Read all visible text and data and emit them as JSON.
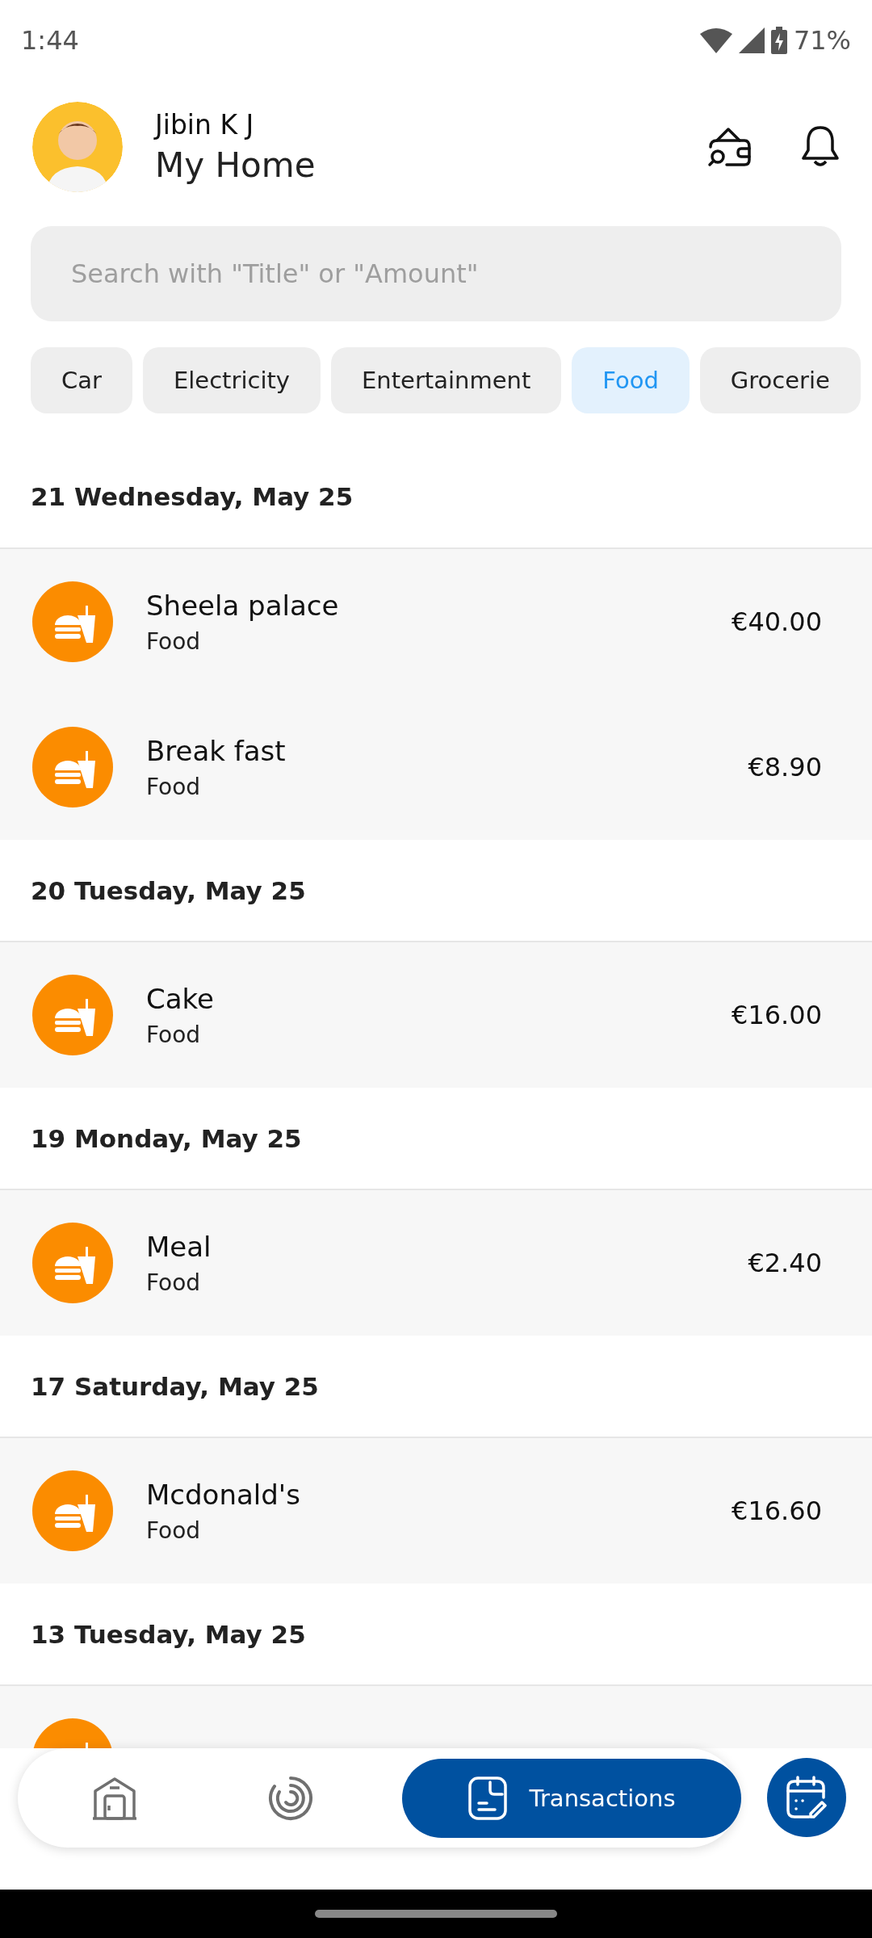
{
  "status_bar": {
    "time": "1:44",
    "battery": "71%"
  },
  "header": {
    "user_name": "Jibin K J",
    "home_name": "My Home"
  },
  "search": {
    "placeholder": "Search with \"Title\" or \"Amount\""
  },
  "categories": [
    {
      "label": "Car",
      "selected": false
    },
    {
      "label": "Electricity",
      "selected": false
    },
    {
      "label": "Entertainment",
      "selected": false
    },
    {
      "label": "Food",
      "selected": true
    },
    {
      "label": "Grocerie",
      "selected": false
    }
  ],
  "groups": [
    {
      "date": "21 Wednesday, May 25",
      "items": [
        {
          "kind": "food",
          "title": "Sheela palace",
          "category": "Food",
          "amount": "€40.00"
        },
        {
          "kind": "food",
          "title": "Break fast",
          "category": "Food",
          "amount": "€8.90"
        }
      ]
    },
    {
      "date": "20 Tuesday, May 25",
      "items": [
        {
          "kind": "food",
          "title": "Cake",
          "category": "Food",
          "amount": "€16.00"
        }
      ]
    },
    {
      "date": "19 Monday, May 25",
      "items": [
        {
          "kind": "food",
          "title": "Meal",
          "category": "Food",
          "amount": "€2.40"
        }
      ]
    },
    {
      "date": "17 Saturday, May 25",
      "items": [
        {
          "kind": "food",
          "title": "Mcdonald's",
          "category": "Food",
          "amount": "€16.60"
        }
      ]
    },
    {
      "date": "13 Tuesday, May 25",
      "items": [
        {
          "kind": "food"
        }
      ]
    }
  ],
  "nav": {
    "items": [
      {
        "kind": "home",
        "selected": false
      },
      {
        "kind": "progress",
        "selected": false
      },
      {
        "kind": "transactions",
        "label": "Transactions",
        "selected": true
      }
    ]
  }
}
